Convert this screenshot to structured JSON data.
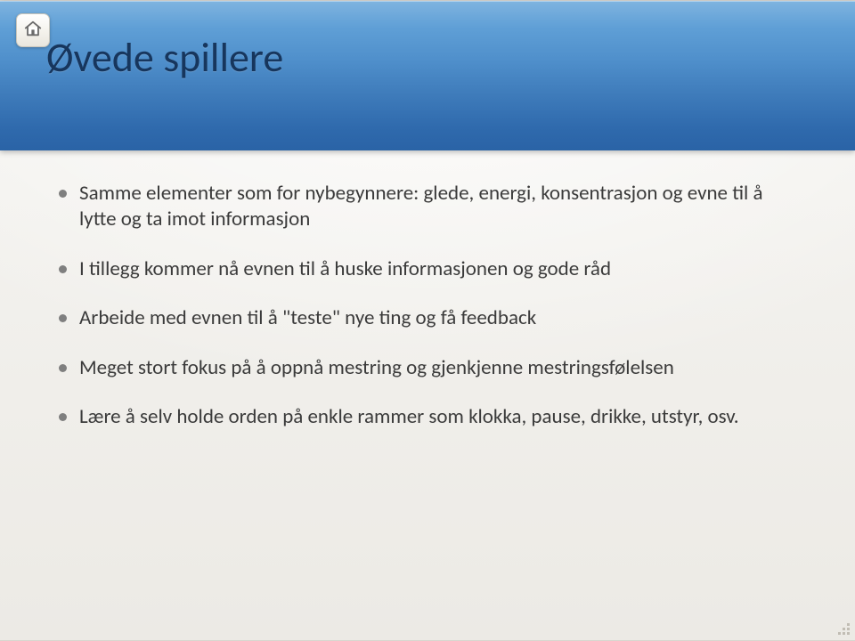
{
  "slide": {
    "title": "Øvede spillere",
    "bullets": [
      "Samme elementer som for nybegynnere: glede, energi, konsentrasjon og evne til å lytte og ta imot informasjon",
      "I tillegg kommer nå evnen til å huske informasjonen og gode råd",
      "Arbeide med evnen til å \"teste\" nye ting og få feedback",
      "Meget stort fokus på å oppnå mestring og gjenkjenne mestringsfølelsen",
      "Lære å selv holde orden på enkle rammer som klokka, pause, drikke, utstyr, osv."
    ]
  },
  "nav": {
    "home_label": "Home"
  }
}
